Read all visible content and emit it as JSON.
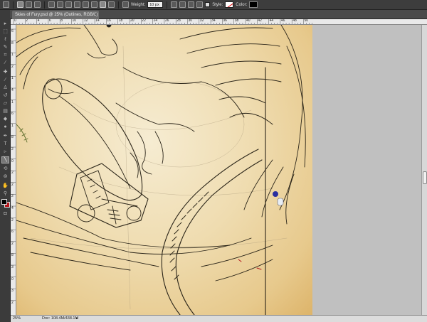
{
  "options_bar": {
    "weight_label": "Weight:",
    "weight_value": "10 px",
    "style_label": "Style:",
    "color_label": "Color:"
  },
  "document": {
    "tab_title": "Skies of Fury.psd @ 25% (Outlines, RGB/8)",
    "close_glyph": "×"
  },
  "rulers": {
    "horizontal": [
      "0",
      "2",
      "4",
      "6",
      "8",
      "10",
      "12",
      "14",
      "16",
      "18",
      "20",
      "22",
      "24",
      "26",
      "28",
      "30",
      "32",
      "34",
      "36",
      "38",
      "40",
      "42",
      "44",
      "46",
      "48",
      "50"
    ],
    "vertical": [
      "6",
      "8",
      "1",
      "2",
      "1",
      "4",
      "1",
      "6",
      "1",
      "8",
      "2",
      "0",
      "2",
      "2",
      "2",
      "4",
      "2",
      "6",
      "2",
      "8",
      "3",
      "0",
      "3",
      "2"
    ]
  },
  "status": {
    "zoom": "25%",
    "doc_size": "Doc: 108.4M/438.1M",
    "arrow": "▸"
  },
  "tools": [
    "move-tool",
    "marquee-tool",
    "lasso-tool",
    "quick-select-tool",
    "crop-tool",
    "eyedropper-tool",
    "healing-tool",
    "brush-tool",
    "clone-stamp-tool",
    "history-brush-tool",
    "eraser-tool",
    "gradient-tool",
    "blur-tool",
    "dodge-tool",
    "pen-tool",
    "type-tool",
    "path-select-tool",
    "line-tool",
    "3d-rotate-tool",
    "3d-orbit-tool",
    "hand-tool",
    "zoom-tool"
  ],
  "colors": {
    "foreground": "#000000",
    "background": "#b4141a",
    "option_color": "#000000"
  }
}
